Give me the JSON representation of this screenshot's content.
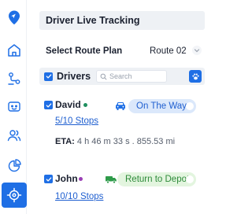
{
  "sidebar": {
    "items": [
      {
        "name": "logo",
        "icon": "map-pin-logo-icon"
      },
      {
        "name": "home",
        "icon": "home-icon"
      },
      {
        "name": "routes",
        "icon": "route-icon"
      },
      {
        "name": "messages",
        "icon": "chat-icon"
      },
      {
        "name": "users",
        "icon": "users-icon"
      },
      {
        "name": "reports",
        "icon": "pie-chart-icon"
      },
      {
        "name": "tracking",
        "icon": "crosshair-icon",
        "active": true
      }
    ]
  },
  "header": {
    "title": "Driver Live Tracking"
  },
  "route_plan": {
    "label": "Select Route Plan",
    "value": "Route 02"
  },
  "drivers": {
    "title": "Drivers",
    "search_placeholder": "Search",
    "list": [
      {
        "name": "David",
        "status_dot_color": "#1f8f5f",
        "vehicle_icon": "car-icon",
        "status": "On The Way",
        "status_bg": "#dbe8fb",
        "status_color": "#1f5fd0",
        "stops": "5/10 Stops",
        "eta_label": "ETA:",
        "eta_value": "4 h 46 m 33 s . 855.53 mi"
      },
      {
        "name": "John",
        "status_dot_color": "#9a3fb5",
        "vehicle_icon": "truck-icon",
        "status": "Return to Depot",
        "status_bg": "#e3f5df",
        "status_color": "#2e8b3a",
        "stops": "10/10 Stops"
      }
    ]
  },
  "colors": {
    "accent": "#1f6fe5",
    "panel_bg": "#eef1f5"
  }
}
